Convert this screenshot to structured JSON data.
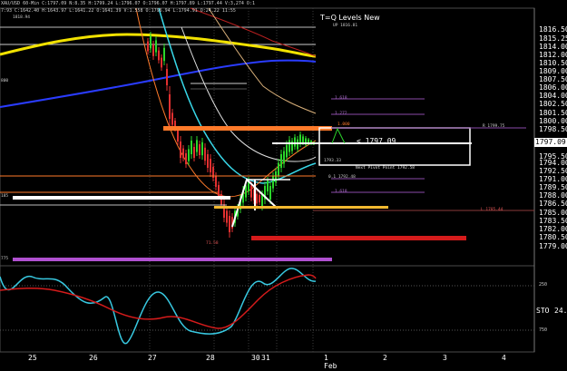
{
  "header": {
    "line1": "XAU/USD 60-Min C:1797.09 N:8.35 H:1799.24 L:1796.07 O:1796.07 H:1797.89 L:1797.44 V:3,274 O:1",
    "line2": "7:93 C:1642.40 H:1643.97 L:1641.22 O:1641.39 V:1.558 O:1796.94 L:1794.91 O:24.22 11:55",
    "ref": "1818.94"
  },
  "title": "T=Q Levels New",
  "annotations": {
    "up": "UP 1816.81",
    "current_price": "< 1797.09",
    "next_pivot": "Next Pivot Point 1792.58",
    "level_1793": "1793.33",
    "level_1792": "0.1 1792.48",
    "level_r": "R 1799.75",
    "level_l": "L 1785.44",
    "low_marker": "71.58",
    "fib_a": "1.618",
    "fib_b": "1.272",
    "fib_c": "1.000",
    "fib_d": "1.618",
    "left_tick": "800",
    "left_tick2": "185",
    "left_tick3": "775"
  },
  "price_axis": {
    "labels": [
      "1816.50",
      "1815.25",
      "1814.00",
      "1812.00",
      "1810.50",
      "1809.00",
      "1807.50",
      "1806.00",
      "1804.00",
      "1802.50",
      "1801.50",
      "1800.00",
      "1798.50",
      "1795.50",
      "1794.00",
      "1792.50",
      "1791.00",
      "1789.50",
      "1788.00",
      "1786.50",
      "1785.00",
      "1783.50",
      "1782.00",
      "1780.50",
      "1779.00"
    ],
    "current": "1797.09"
  },
  "oscillator": {
    "name": "STO",
    "value": "24.",
    "tick_top": "250",
    "tick_bottom": "750"
  },
  "date_axis": [
    "25",
    "26",
    "27",
    "28",
    "30",
    "31",
    "1",
    "2",
    "3",
    "4"
  ],
  "month_label": "Feb",
  "colors": {
    "background": "#000000",
    "orange": "#ff7a2a",
    "yellow": "#f2e200",
    "blue": "#2a3cff",
    "cyan": "#38d7e8",
    "red": "#d51b1b",
    "green": "#2bd62b",
    "purple": "#b050d0",
    "white": "#ffffff"
  }
}
